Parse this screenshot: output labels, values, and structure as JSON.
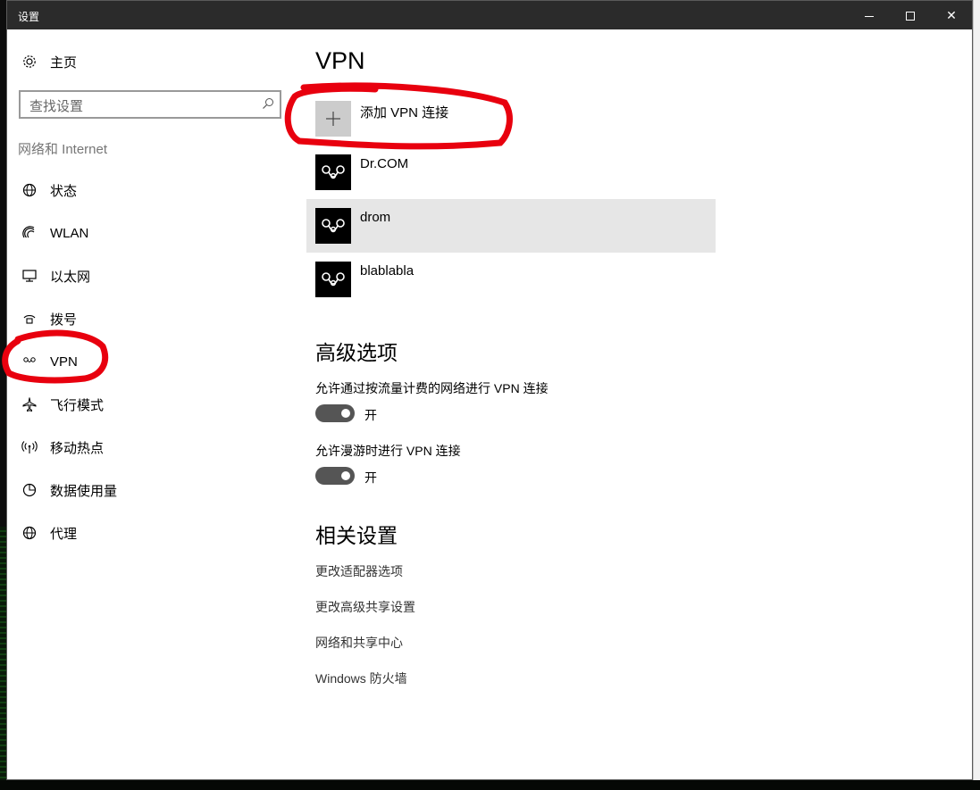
{
  "window": {
    "title": "设置",
    "min_label": "minimize",
    "max_label": "maximize",
    "close_label": "✕"
  },
  "sidebar": {
    "home_label": "主页",
    "search_placeholder": "查找设置",
    "section_title": "网络和 Internet",
    "items": [
      {
        "label": "状态",
        "icon": "globe-status-icon"
      },
      {
        "label": "WLAN",
        "icon": "wifi-icon"
      },
      {
        "label": "以太网",
        "icon": "ethernet-icon"
      },
      {
        "label": "拨号",
        "icon": "dialup-icon"
      },
      {
        "label": "VPN",
        "icon": "vpn-icon"
      },
      {
        "label": "飞行模式",
        "icon": "airplane-icon"
      },
      {
        "label": "移动热点",
        "icon": "hotspot-icon"
      },
      {
        "label": "数据使用量",
        "icon": "data-usage-icon"
      },
      {
        "label": "代理",
        "icon": "proxy-globe-icon"
      }
    ],
    "selected_item": "VPN"
  },
  "main": {
    "title": "VPN",
    "add_vpn_label": "添加 VPN 连接",
    "connections": [
      {
        "name": "Dr.COM",
        "selected": false
      },
      {
        "name": "drom",
        "selected": true
      },
      {
        "name": "blablabla",
        "selected": false
      }
    ],
    "advanced": {
      "heading": "高级选项",
      "options": [
        {
          "label": "允许通过按流量计费的网络进行 VPN 连接",
          "state": "开",
          "on": true
        },
        {
          "label": "允许漫游时进行 VPN 连接",
          "state": "开",
          "on": true
        }
      ]
    },
    "related": {
      "heading": "相关设置",
      "links": [
        "更改适配器选项",
        "更改高级共享设置",
        "网络和共享中心",
        "Windows 防火墙"
      ]
    }
  },
  "colors": {
    "titlebar": "#2b2b2b",
    "annotation": "#e8000e",
    "toggle_on": "#555555",
    "selected_row": "#e6e6e6"
  }
}
